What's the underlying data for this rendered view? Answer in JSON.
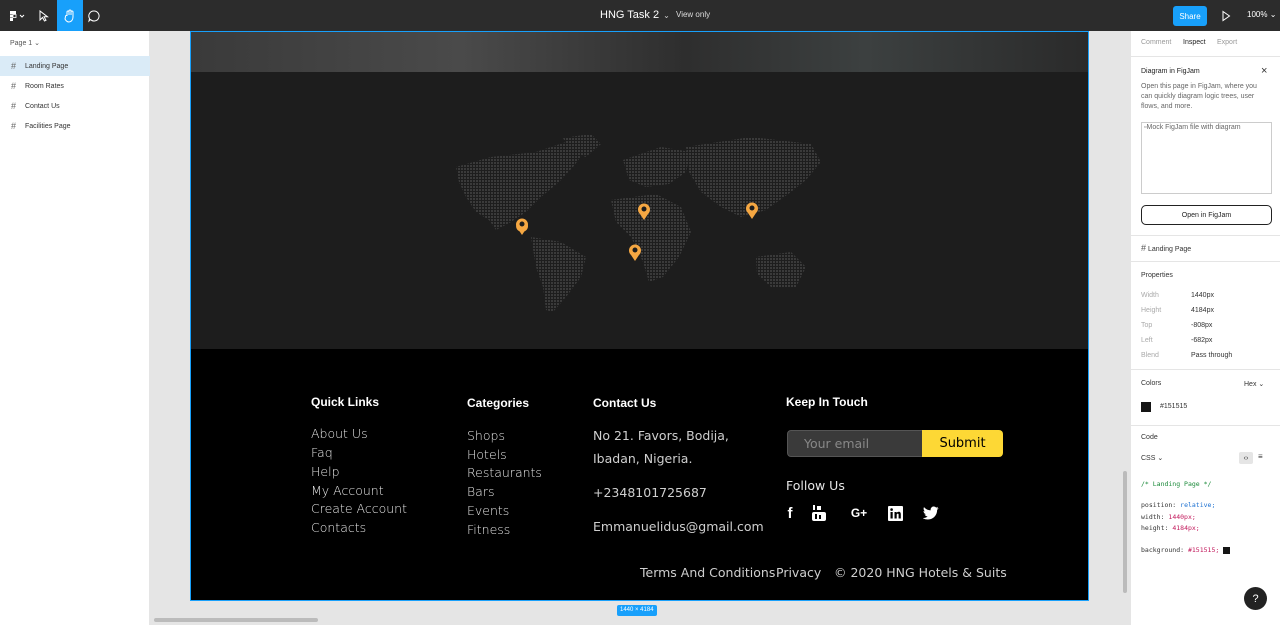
{
  "topbar": {
    "file_title": "HNG Task 2",
    "view_mode": "View only",
    "share_label": "Share",
    "zoom": "100%"
  },
  "left_panel": {
    "page_selector": "Page 1",
    "layers": [
      "Landing Page",
      "Room Rates",
      "Contact Us",
      "Facilities Page"
    ]
  },
  "canvas": {
    "frame_size_badge": "1440 × 4184",
    "footer": {
      "quick_links": {
        "heading": "Quick Links",
        "items": [
          "About Us",
          "Faq",
          "Help",
          "My Account",
          "Create Account",
          "Contacts"
        ]
      },
      "categories": {
        "heading": "Categories",
        "items": [
          "Shops",
          "Hotels",
          "Restaurants",
          "Bars",
          "Events",
          "Fitness"
        ]
      },
      "contact": {
        "heading": "Contact Us",
        "address_line1": "No 21. Favors, Bodija,",
        "address_line2": "Ibadan, Nigeria.",
        "phone": "+2348101725687",
        "email": "Emmanuelidus@gmail.com"
      },
      "keep_in_touch": {
        "heading": "Keep In Touch",
        "email_placeholder": "Your email",
        "submit_label": "Submit",
        "follow_us": "Follow Us"
      },
      "bottom": {
        "terms": "Terms And Conditions",
        "privacy": "Privacy",
        "copyright": "© 2020 HNG Hotels & Suits"
      }
    }
  },
  "right_panel": {
    "tabs": [
      "Comment",
      "Inspect",
      "Export"
    ],
    "figjam": {
      "title": "Diagram in FigJam",
      "desc_line1": "Open this page in FigJam, where you",
      "desc_line2": "can quickly diagram logic trees, user",
      "desc_line3": "flows, and more.",
      "image_alt": "Mock FigJam file with diagram",
      "open_button": "Open in FigJam"
    },
    "selection_name": "Landing Page",
    "properties": {
      "heading": "Properties",
      "rows": [
        {
          "key": "Width",
          "value": "1440px"
        },
        {
          "key": "Height",
          "value": "4184px"
        },
        {
          "key": "Top",
          "value": "-808px"
        },
        {
          "key": "Left",
          "value": "-682px"
        },
        {
          "key": "Blend",
          "value": "Pass through"
        }
      ]
    },
    "colors": {
      "heading": "Colors",
      "format": "Hex",
      "swatch_hex": "#151515"
    },
    "code": {
      "heading": "Code",
      "language": "CSS",
      "comment": "/* Landing Page */",
      "line_position_prop": "position:",
      "line_position_val": "relative;",
      "line_width_prop": "width:",
      "line_width_val": "1440px;",
      "line_height_prop": "height:",
      "line_height_val": "4184px;",
      "line_bg_prop": "background:",
      "line_bg_val": "#151515;"
    },
    "help_label": "?"
  },
  "colors": {
    "accent_blue": "#18a0fb",
    "submit_yellow": "#fdd835",
    "pin_orange": "#f5a742",
    "footer_bg": "#000000",
    "map_bg": "#1d1d1d"
  }
}
